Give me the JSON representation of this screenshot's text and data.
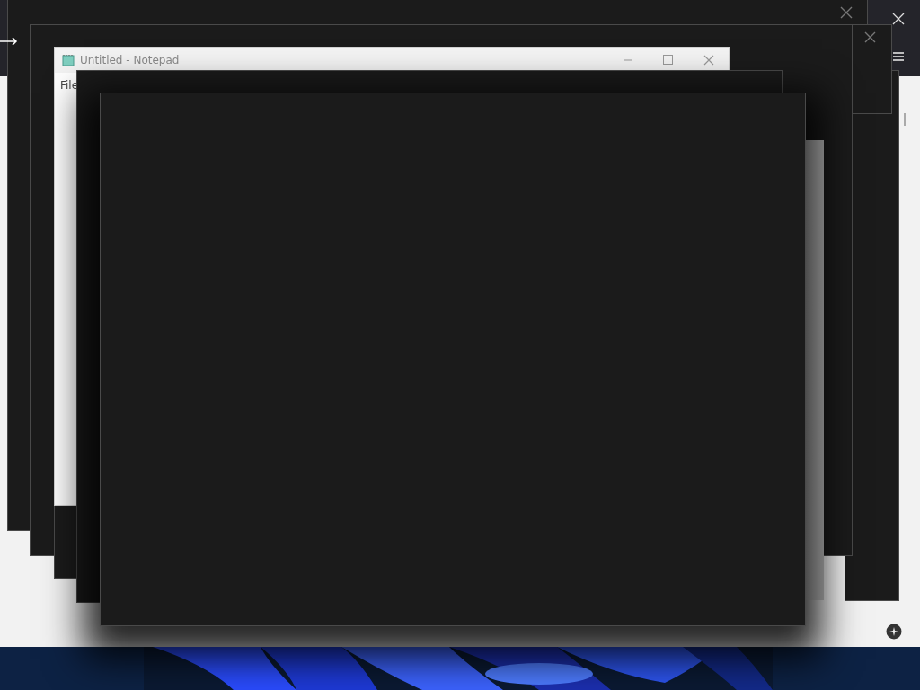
{
  "notepad": {
    "title": "Untitled - Notepad",
    "menu": [
      "File"
    ]
  }
}
